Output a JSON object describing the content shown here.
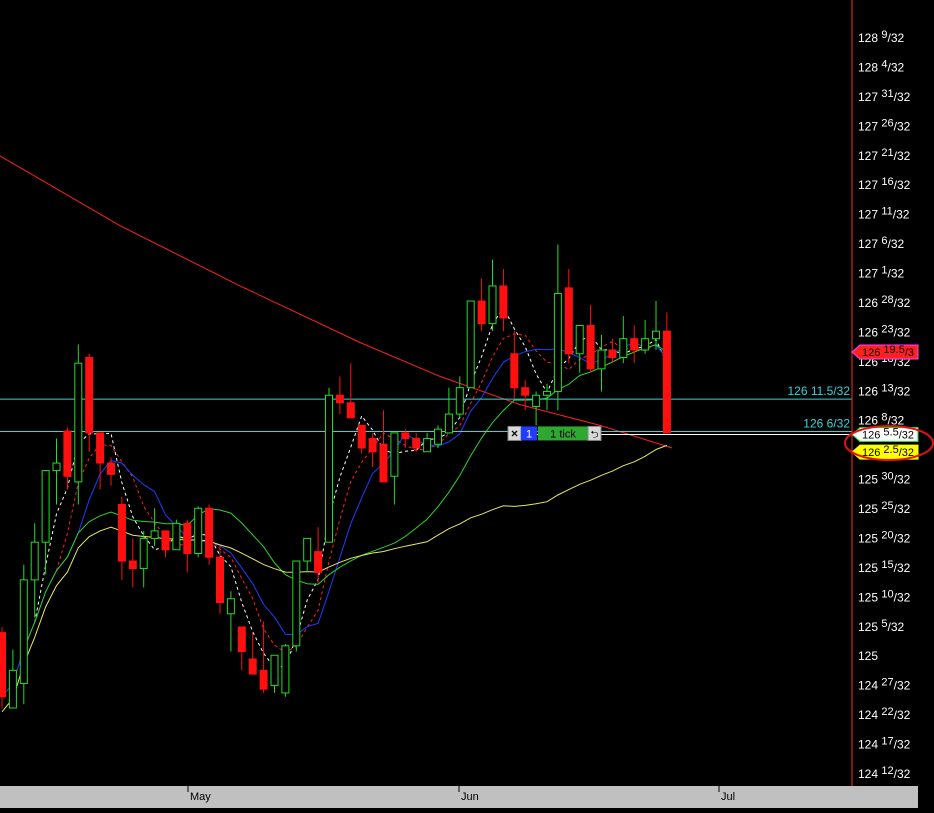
{
  "colors": {
    "background": "#000000",
    "axis_line": "#ff2a2a",
    "up_candle": "#22dd22",
    "down_candle": "#ff1010",
    "ma_red": "#ff2020",
    "ma_blue": "#1f3dff",
    "ma_green": "#2fcf2f",
    "ma_yellow": "#e8e860",
    "ma_white_dashed": "#ffffff",
    "ma_red_dashed": "#ff2020",
    "hline": "#30d8d8",
    "hline_label": "#30d8d8",
    "price_axis_text": "#ffffff",
    "xaxis_bg": "#c0c0c0",
    "annotation_circle": "#e81010"
  },
  "chart_data": {
    "type": "candlestick",
    "symbol_units": "32nds",
    "x_labels": [
      "May",
      "Jun",
      "Jul"
    ],
    "y_tick_labels": [
      {
        "whole": "128",
        "frac": "9/32",
        "value": 128.28125
      },
      {
        "whole": "128",
        "frac": "4/32",
        "value": 128.125
      },
      {
        "whole": "127",
        "frac": "31/32",
        "value": 127.96875
      },
      {
        "whole": "127",
        "frac": "26/32",
        "value": 127.8125
      },
      {
        "whole": "127",
        "frac": "21/32",
        "value": 127.65625
      },
      {
        "whole": "127",
        "frac": "16/32",
        "value": 127.5
      },
      {
        "whole": "127",
        "frac": "11/32",
        "value": 127.34375
      },
      {
        "whole": "127",
        "frac": "6/32",
        "value": 127.1875
      },
      {
        "whole": "127",
        "frac": "1/32",
        "value": 127.03125
      },
      {
        "whole": "126",
        "frac": "28/32",
        "value": 126.875
      },
      {
        "whole": "126",
        "frac": "23/32",
        "value": 126.71875
      },
      {
        "whole": "126",
        "frac": "18/32",
        "value": 126.5625
      },
      {
        "whole": "126",
        "frac": "13/32",
        "value": 126.40625
      },
      {
        "whole": "126",
        "frac": "8/32",
        "value": 126.25
      },
      {
        "whole": "125",
        "frac": "30/32",
        "value": 125.9375
      },
      {
        "whole": "125",
        "frac": "25/32",
        "value": 125.78125
      },
      {
        "whole": "125",
        "frac": "20/32",
        "value": 125.625
      },
      {
        "whole": "125",
        "frac": "15/32",
        "value": 125.46875
      },
      {
        "whole": "125",
        "frac": "10/32",
        "value": 125.3125
      },
      {
        "whole": "125",
        "frac": "5/32",
        "value": 125.15625
      },
      {
        "whole": "125",
        "frac": "",
        "value": 125.0
      },
      {
        "whole": "124",
        "frac": "27/32",
        "value": 124.84375
      },
      {
        "whole": "124",
        "frac": "22/32",
        "value": 124.6875
      },
      {
        "whole": "124",
        "frac": "17/32",
        "value": 124.53125
      },
      {
        "whole": "124",
        "frac": "12/32",
        "value": 124.375
      }
    ],
    "horizontal_lines": [
      {
        "label": "126 11.5/32",
        "value": 126.359375
      },
      {
        "label": "126 6/32",
        "value": 126.1875
      }
    ],
    "price_markers": [
      {
        "whole": "126",
        "frac": "19.5/3",
        "value": 126.609375,
        "bg": "#ff2020",
        "fg": "#000000",
        "border": "#ff40ff"
      },
      {
        "whole": "126",
        "frac": "5.5/32",
        "value": 126.171875,
        "bg": "#ffffff",
        "fg": "#000000",
        "border": "#22dd22"
      },
      {
        "whole": "126",
        "frac": "2.5/32",
        "value": 126.078125,
        "bg": "#ffff00",
        "fg": "#000000",
        "border": "#ffff00"
      }
    ],
    "order_widget": {
      "close_symbol": "×",
      "quantity": "1",
      "label": "1 tick",
      "cancel_symbol": "⮌",
      "value": 126.171875
    },
    "ylim": [
      124.33,
      128.38
    ],
    "candle_count": 62,
    "candles": [
      {
        "o": 125.12,
        "h": 125.15,
        "l": 124.72,
        "c": 124.78
      },
      {
        "o": 124.72,
        "h": 125.03,
        "l": 124.8,
        "c": 124.92
      },
      {
        "o": 124.85,
        "h": 125.48,
        "l": 124.74,
        "c": 125.4
      },
      {
        "o": 125.4,
        "h": 125.7,
        "l": 125.2,
        "c": 125.6
      },
      {
        "o": 125.6,
        "h": 125.86,
        "l": 125.43,
        "c": 125.98
      },
      {
        "o": 125.98,
        "h": 126.15,
        "l": 125.8,
        "c": 126.02
      },
      {
        "o": 126.19,
        "h": 126.21,
        "l": 125.88,
        "c": 125.95
      },
      {
        "o": 125.92,
        "h": 126.65,
        "l": 125.8,
        "c": 126.55
      },
      {
        "o": 126.58,
        "h": 126.6,
        "l": 126.08,
        "c": 126.18
      },
      {
        "o": 126.18,
        "h": 126.18,
        "l": 125.88,
        "c": 126.02
      },
      {
        "o": 126.02,
        "h": 126.05,
        "l": 125.9,
        "c": 125.96
      },
      {
        "o": 125.8,
        "h": 125.84,
        "l": 125.4,
        "c": 125.5
      },
      {
        "o": 125.5,
        "h": 125.62,
        "l": 125.36,
        "c": 125.46
      },
      {
        "o": 125.46,
        "h": 125.66,
        "l": 125.36,
        "c": 125.62
      },
      {
        "o": 125.62,
        "h": 125.78,
        "l": 125.58,
        "c": 125.66
      },
      {
        "o": 125.66,
        "h": 125.66,
        "l": 125.52,
        "c": 125.56
      },
      {
        "o": 125.56,
        "h": 125.72,
        "l": 125.56,
        "c": 125.7
      },
      {
        "o": 125.7,
        "h": 125.72,
        "l": 125.44,
        "c": 125.54
      },
      {
        "o": 125.54,
        "h": 125.79,
        "l": 125.52,
        "c": 125.78
      },
      {
        "o": 125.78,
        "h": 125.8,
        "l": 125.48,
        "c": 125.52
      },
      {
        "o": 125.52,
        "h": 125.58,
        "l": 125.22,
        "c": 125.28
      },
      {
        "o": 125.22,
        "h": 125.34,
        "l": 125.02,
        "c": 125.3
      },
      {
        "o": 125.15,
        "h": 125.15,
        "l": 124.92,
        "c": 125.02
      },
      {
        "o": 124.98,
        "h": 125.12,
        "l": 124.9,
        "c": 124.9
      },
      {
        "o": 124.92,
        "h": 125.18,
        "l": 124.8,
        "c": 124.82
      },
      {
        "o": 124.84,
        "h": 125.0,
        "l": 124.8,
        "c": 125.0
      },
      {
        "o": 124.8,
        "h": 125.06,
        "l": 124.78,
        "c": 125.05
      },
      {
        "o": 125.05,
        "h": 125.5,
        "l": 125.02,
        "c": 125.5
      },
      {
        "o": 125.5,
        "h": 125.62,
        "l": 125.44,
        "c": 125.62
      },
      {
        "o": 125.55,
        "h": 125.68,
        "l": 125.38,
        "c": 125.44
      },
      {
        "o": 125.6,
        "h": 126.42,
        "l": 125.6,
        "c": 126.38
      },
      {
        "o": 126.38,
        "h": 126.48,
        "l": 126.28,
        "c": 126.34
      },
      {
        "o": 126.34,
        "h": 126.55,
        "l": 126.26,
        "c": 126.26
      },
      {
        "o": 126.22,
        "h": 126.22,
        "l": 126.07,
        "c": 126.1
      },
      {
        "o": 126.15,
        "h": 126.18,
        "l": 126.0,
        "c": 126.08
      },
      {
        "o": 126.12,
        "h": 126.3,
        "l": 125.98,
        "c": 125.92
      },
      {
        "o": 125.95,
        "h": 126.18,
        "l": 125.8,
        "c": 126.18
      },
      {
        "o": 126.18,
        "h": 126.2,
        "l": 126.1,
        "c": 126.15
      },
      {
        "o": 126.15,
        "h": 126.18,
        "l": 126.08,
        "c": 126.1
      },
      {
        "o": 126.08,
        "h": 126.18,
        "l": 126.08,
        "c": 126.15
      },
      {
        "o": 126.12,
        "h": 126.22,
        "l": 126.1,
        "c": 126.2
      },
      {
        "o": 126.18,
        "h": 126.42,
        "l": 126.18,
        "c": 126.28
      },
      {
        "o": 126.28,
        "h": 126.48,
        "l": 126.26,
        "c": 126.42
      },
      {
        "o": 126.42,
        "h": 126.88,
        "l": 126.42,
        "c": 126.88
      },
      {
        "o": 126.88,
        "h": 127.0,
        "l": 126.72,
        "c": 126.76
      },
      {
        "o": 126.76,
        "h": 127.1,
        "l": 126.72,
        "c": 126.96
      },
      {
        "o": 126.96,
        "h": 127.05,
        "l": 126.72,
        "c": 126.79
      },
      {
        "o": 126.6,
        "h": 126.72,
        "l": 126.36,
        "c": 126.42
      },
      {
        "o": 126.42,
        "h": 126.46,
        "l": 126.3,
        "c": 126.38
      },
      {
        "o": 126.32,
        "h": 126.4,
        "l": 126.22,
        "c": 126.38
      },
      {
        "o": 126.38,
        "h": 126.44,
        "l": 126.3,
        "c": 126.4
      },
      {
        "o": 126.4,
        "h": 127.18,
        "l": 126.3,
        "c": 126.92
      },
      {
        "o": 126.95,
        "h": 127.05,
        "l": 126.55,
        "c": 126.6
      },
      {
        "o": 126.6,
        "h": 126.75,
        "l": 126.5,
        "c": 126.75
      },
      {
        "o": 126.75,
        "h": 126.86,
        "l": 126.5,
        "c": 126.52
      },
      {
        "o": 126.52,
        "h": 126.7,
        "l": 126.4,
        "c": 126.62
      },
      {
        "o": 126.62,
        "h": 126.68,
        "l": 126.55,
        "c": 126.58
      },
      {
        "o": 126.58,
        "h": 126.8,
        "l": 126.55,
        "c": 126.68
      },
      {
        "o": 126.68,
        "h": 126.75,
        "l": 126.55,
        "c": 126.62
      },
      {
        "o": 126.62,
        "h": 126.78,
        "l": 126.6,
        "c": 126.68
      },
      {
        "o": 126.68,
        "h": 126.88,
        "l": 126.62,
        "c": 126.72
      },
      {
        "o": 126.72,
        "h": 126.82,
        "l": 126.18,
        "c": 126.18
      }
    ]
  }
}
